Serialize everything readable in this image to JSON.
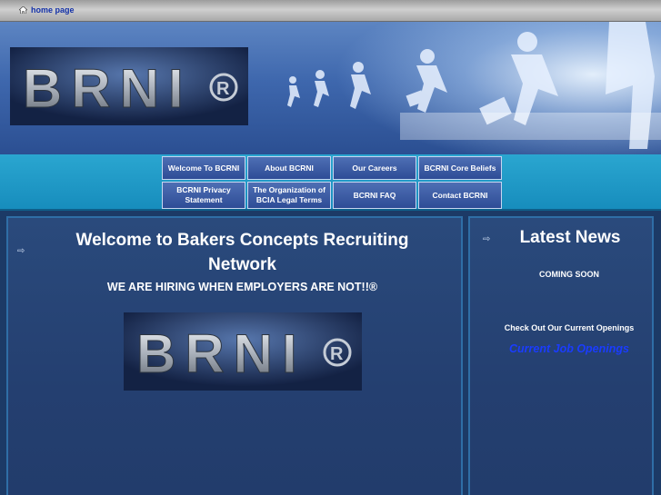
{
  "topbar": {
    "home_label": "home page"
  },
  "banner": {
    "logo_text": "BRNI",
    "logo_mark": "®"
  },
  "nav": {
    "items": [
      "Welcome To BCRNI",
      "About BCRNI",
      "Our Careers",
      "BCRNI Core Beliefs",
      "BCRNI Privacy Statement",
      "The Organization of BCIA Legal Terms",
      "BCRNI FAQ",
      "Contact BCRNI"
    ]
  },
  "main": {
    "title": "Welcome to Bakers Concepts Recruiting Network",
    "tagline": "WE ARE HIRING WHEN EMPLOYERS ARE NOT!!®",
    "logo_text": "BRNI",
    "logo_mark": "®"
  },
  "side": {
    "title": "Latest News",
    "coming_soon": "COMING SOON",
    "check_text": "Check Out Our Current Openings",
    "jobs_link": "Current Job Openings"
  },
  "colors": {
    "accent": "#1a3cff",
    "nav_bg": "#3a5ca4",
    "strip": "#1f9ac8"
  },
  "icons": [
    "home-icon",
    "arrow-icon"
  ]
}
